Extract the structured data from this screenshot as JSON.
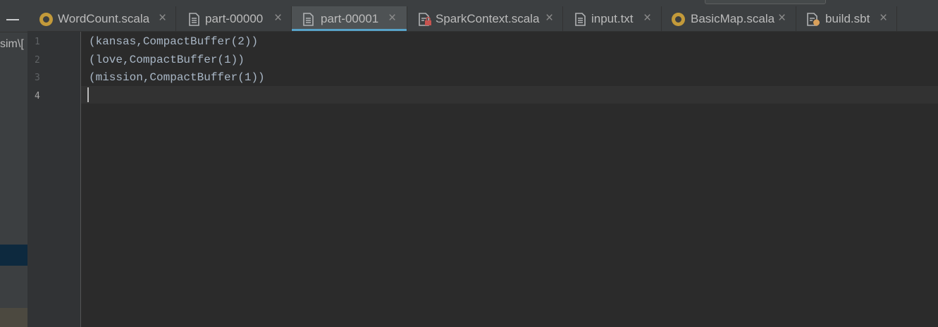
{
  "left_panel": {
    "path_fragment": "sim\\["
  },
  "tabs": [
    {
      "label": "WordCount.scala",
      "icon": "scala-object-icon",
      "active": false
    },
    {
      "label": "part-00000",
      "icon": "text-file-icon",
      "active": false
    },
    {
      "label": "part-00001",
      "icon": "text-file-icon",
      "active": true
    },
    {
      "label": "SparkContext.scala",
      "icon": "locked-class-file-icon",
      "active": false
    },
    {
      "label": "input.txt",
      "icon": "text-file-icon",
      "active": false
    },
    {
      "label": "BasicMap.scala",
      "icon": "scala-object-icon",
      "active": false
    },
    {
      "label": "build.sbt",
      "icon": "sbt-file-icon",
      "active": false
    }
  ],
  "editor": {
    "line_numbers": [
      "1",
      "2",
      "3",
      "4"
    ],
    "current_line": 4,
    "lines": [
      "(kansas,CompactBuffer(2))",
      "(love,CompactBuffer(1))",
      "(mission,CompactBuffer(1))",
      ""
    ]
  },
  "colors": {
    "background": "#2b2b2b",
    "panel": "#3c3f41",
    "active_tab_underline": "#58a3c8",
    "scala_icon": "#c39a3a",
    "code_text": "#a9b7c6"
  }
}
